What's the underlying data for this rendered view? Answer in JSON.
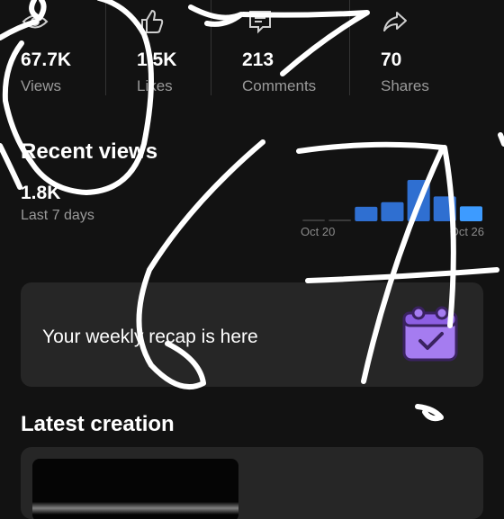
{
  "stats": [
    {
      "value": "67.7K",
      "label": "Views",
      "icon": "eye-icon"
    },
    {
      "value": "1.5K",
      "label": "Likes",
      "icon": "thumbs-up-icon"
    },
    {
      "value": "213",
      "label": "Comments",
      "icon": "comment-icon"
    },
    {
      "value": "70",
      "label": "Shares",
      "icon": "share-icon"
    }
  ],
  "recent_views": {
    "title": "Recent views",
    "value": "1.8K",
    "subtitle": "Last 7 days",
    "chart_data": {
      "type": "bar",
      "x_start_label": "Oct 20",
      "x_end_label": "Oct 26",
      "values": [
        0.03,
        0.03,
        0.35,
        0.46,
        1.0,
        0.6,
        0.36
      ],
      "bar_colors": [
        "#3a3a3a",
        "#3a3a3a",
        "#2f6fd1",
        "#2f6fd1",
        "#2f6fd1",
        "#2f6fd1",
        "#3d9bff"
      ]
    }
  },
  "recap": {
    "text": "Your weekly recap is here",
    "icon": "calendar-check-icon",
    "icon_color": "#a57cf0"
  },
  "latest_creation": {
    "title": "Latest creation"
  },
  "colors": {
    "background": "#121212",
    "card": "#262626",
    "muted_text": "#9a9a9a",
    "accent_blue": "#2f6fd1",
    "scribble": "#ffffff"
  }
}
